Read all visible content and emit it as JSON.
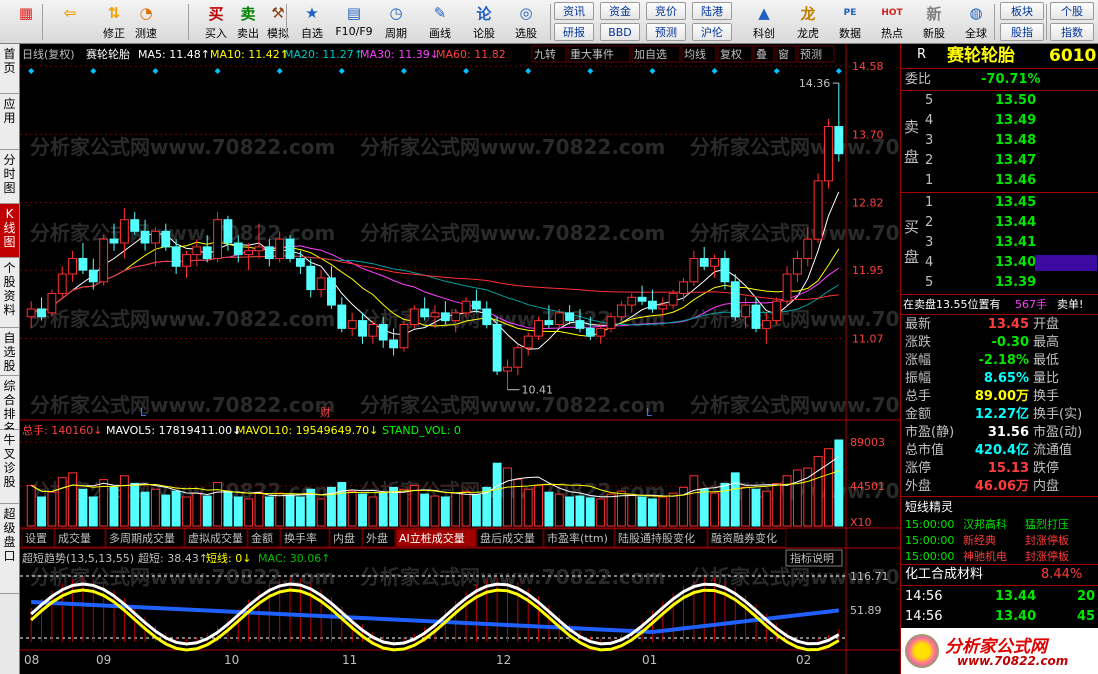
{
  "toolbar": {
    "buttons": [
      {
        "label": "",
        "icon": "windows-grid-icon"
      },
      {
        "label": "",
        "icon": "back-arrow-icon"
      },
      {
        "label": "修正",
        "icon": "up-down-arrows-icon"
      },
      {
        "label": "测速",
        "icon": "speed-icon"
      },
      {
        "label": "买入",
        "icon": "buy-icon",
        "glyph": "买"
      },
      {
        "label": "卖出",
        "icon": "sell-icon",
        "glyph": "卖"
      },
      {
        "label": "模拟",
        "icon": "hammer-icon"
      },
      {
        "label": "自选",
        "icon": "star-icon"
      },
      {
        "label": "F10/F9",
        "icon": "f10-icon"
      },
      {
        "label": "周期",
        "icon": "period-icon"
      },
      {
        "label": "画线",
        "icon": "pencil-icon"
      },
      {
        "label": "论股",
        "icon": "discuss-icon",
        "glyph": "论"
      },
      {
        "label": "选股",
        "icon": "select-stock-icon"
      }
    ],
    "mid_buttons": [
      [
        "资讯",
        "研报"
      ],
      [
        "资金",
        "BBD"
      ],
      [
        "竞价",
        "预测"
      ],
      [
        "陆港",
        "沪伦"
      ]
    ],
    "right_buttons": [
      {
        "label": "科创",
        "icon": "kechuang-icon"
      },
      {
        "label": "龙虎",
        "icon": "dragon-tiger-icon"
      },
      {
        "label": "数据",
        "icon": "pe-icon",
        "glyph": "PE"
      },
      {
        "label": "热点",
        "icon": "hot-icon",
        "glyph": "HOT"
      },
      {
        "label": "新股",
        "icon": "new-stock-icon"
      },
      {
        "label": "全球",
        "icon": "globe-icon"
      }
    ],
    "far_right": [
      [
        "板块",
        "股指"
      ],
      [
        "个股",
        "指数"
      ]
    ]
  },
  "left_tabs": [
    "首页",
    "应用",
    "分时图",
    "K线图",
    "个股资料",
    "自选股",
    "综合排名",
    "牛叉诊股",
    "超级盘口"
  ],
  "chart_header": {
    "title": "日线(复权)",
    "stock": "赛轮轮胎",
    "ma": [
      {
        "label": "MA5: 11.48↑",
        "color": "#ffffff"
      },
      {
        "label": "MA10: 11.42↑",
        "color": "#ffff00"
      },
      {
        "label": "MA20: 11.27↑",
        "color": "#00c8c8"
      },
      {
        "label": "MA30: 11.39↓",
        "color": "#ff40ff"
      },
      {
        "label": "MA60: 11.82",
        "color": "#ff4040"
      }
    ],
    "buttons": [
      "九转",
      "重大事件",
      "加自选",
      "均线",
      "复权",
      "叠",
      "窗",
      "预测"
    ]
  },
  "price_axis": [
    "14.58",
    "13.70",
    "12.82",
    "11.95",
    "11.07"
  ],
  "price_annotations": {
    "high": "14.36",
    "low": "10.41",
    "marks": [
      "L",
      "财",
      "L"
    ]
  },
  "volume_header": {
    "items": [
      {
        "label": "总手: 140160↓",
        "color": "#ff4040"
      },
      {
        "label": "MAVOL5: 17819411.00↓",
        "color": "#ffffff"
      },
      {
        "label": "MAVOL10: 19549649.70↓",
        "color": "#ffff00"
      },
      {
        "label": "STAND_VOL: 0",
        "color": "#00ff00"
      }
    ]
  },
  "volume_axis": [
    "89003",
    "44501",
    "X10"
  ],
  "indicator_tabs": [
    "设置",
    "成交量",
    "多周期成交量",
    "虚拟成交量",
    "金额",
    "换手率",
    "内盘",
    "外盘",
    "AI立桩成交量",
    "盘后成交量",
    "市盈率(ttm)",
    "陆股通持股变化",
    "融资融券变化"
  ],
  "indicator_active": "AI立桩成交量",
  "osc_header": {
    "items": [
      {
        "label": "超短趋势(13,5,13,55)",
        "color": "#c0c0c0"
      },
      {
        "label": "超短: 38.43↑",
        "color": "#c0c0c0"
      },
      {
        "label": "短线: 0↓",
        "color": "#ffff00"
      },
      {
        "label": "MAC: 30.06↑",
        "color": "#00c000"
      }
    ],
    "help": "指标说明"
  },
  "osc_axis": [
    "116.71",
    "51.89"
  ],
  "date_axis": [
    "08",
    "09",
    "10",
    "11",
    "12",
    "01",
    "02"
  ],
  "watermark": "分析家公式网www.70822.com",
  "right_panel": {
    "title_r": "R",
    "title_name": "赛轮轮胎",
    "title_code": "6010",
    "weibi_label": "委比",
    "weibi_value": "-70.71%",
    "sell_label": [
      "卖",
      "盘"
    ],
    "buy_label": [
      "买",
      "盘"
    ],
    "sell": [
      {
        "level": "5",
        "price": "13.50"
      },
      {
        "level": "4",
        "price": "13.49"
      },
      {
        "level": "3",
        "price": "13.48"
      },
      {
        "level": "2",
        "price": "13.47"
      },
      {
        "level": "1",
        "price": "13.46"
      }
    ],
    "buy": [
      {
        "level": "1",
        "price": "13.45"
      },
      {
        "level": "2",
        "price": "13.44"
      },
      {
        "level": "3",
        "price": "13.41"
      },
      {
        "level": "4",
        "price": "13.40"
      },
      {
        "level": "5",
        "price": "13.39"
      }
    ],
    "position_text": "在卖盘13.55位置有",
    "position_qty": "567手",
    "position_sell": "卖单!",
    "stats": [
      {
        "l": "最新",
        "v": "13.45",
        "vc": "red",
        "r": "开盘"
      },
      {
        "l": "涨跌",
        "v": "-0.30",
        "vc": "grn",
        "r": "最高"
      },
      {
        "l": "涨幅",
        "v": "-2.18%",
        "vc": "grn",
        "r": "最低"
      },
      {
        "l": "振幅",
        "v": "8.65%",
        "vc": "cyan",
        "r": "量比"
      },
      {
        "l": "总手",
        "v": "89.00万",
        "vc": "yel",
        "r": "换手"
      },
      {
        "l": "金额",
        "v": "12.27亿",
        "vc": "cyan",
        "r": "换手(实)"
      },
      {
        "l": "市盈(静)",
        "v": "31.56",
        "vc": "wht",
        "r": "市盈(动)"
      },
      {
        "l": "总市值",
        "v": "420.4亿",
        "vc": "cyan",
        "r": "流通值"
      },
      {
        "l": "涨停",
        "v": "15.13",
        "vc": "red",
        "r": "跌停"
      },
      {
        "l": "外盘",
        "v": "46.06万",
        "vc": "red",
        "r": "内盘"
      }
    ],
    "jingling_title": "短线精灵",
    "jingling": [
      {
        "t": "15:00:00",
        "n": "汉邦高科",
        "e": "猛烈打压"
      },
      {
        "t": "15:00:00",
        "n": "新经典",
        "e": "封涨停板"
      },
      {
        "t": "15:00:00",
        "n": "神驰机电",
        "e": "封涨停板"
      }
    ],
    "sector_name": "化工合成材料",
    "sector_pct": "8.44%",
    "ticks": [
      {
        "t": "14:56",
        "p": "13.44",
        "v": "20"
      },
      {
        "t": "14:56",
        "p": "13.40",
        "v": "45"
      }
    ],
    "logo_main": "分析家公式网",
    "logo_url": "www.70822.com"
  },
  "chart_data": {
    "type": "candlestick",
    "price_ylim": [
      10.2,
      14.58
    ],
    "candles": [
      [
        11.35,
        11.55,
        11.2,
        11.45
      ],
      [
        11.45,
        11.6,
        11.3,
        11.35
      ],
      [
        11.4,
        11.7,
        11.35,
        11.65
      ],
      [
        11.65,
        12.0,
        11.6,
        11.9
      ],
      [
        11.9,
        12.2,
        11.8,
        12.1
      ],
      [
        12.1,
        12.3,
        11.9,
        11.95
      ],
      [
        11.95,
        12.1,
        11.7,
        11.8
      ],
      [
        11.8,
        12.4,
        11.75,
        12.35
      ],
      [
        12.35,
        12.55,
        12.2,
        12.3
      ],
      [
        12.3,
        12.75,
        12.1,
        12.6
      ],
      [
        12.6,
        12.7,
        12.4,
        12.45
      ],
      [
        12.45,
        12.6,
        12.2,
        12.3
      ],
      [
        12.3,
        12.5,
        12.0,
        12.45
      ],
      [
        12.45,
        12.55,
        12.2,
        12.25
      ],
      [
        12.25,
        12.35,
        11.9,
        12.0
      ],
      [
        12.0,
        12.2,
        11.85,
        12.15
      ],
      [
        12.15,
        12.35,
        12.0,
        12.25
      ],
      [
        12.25,
        12.4,
        12.05,
        12.1
      ],
      [
        12.1,
        12.7,
        12.05,
        12.6
      ],
      [
        12.6,
        12.65,
        12.2,
        12.3
      ],
      [
        12.3,
        12.4,
        12.05,
        12.15
      ],
      [
        12.15,
        12.3,
        11.95,
        12.2
      ],
      [
        12.2,
        12.55,
        12.1,
        12.25
      ],
      [
        12.25,
        12.35,
        12.0,
        12.1
      ],
      [
        12.1,
        12.45,
        12.05,
        12.35
      ],
      [
        12.35,
        12.4,
        12.05,
        12.1
      ],
      [
        12.1,
        12.2,
        11.9,
        12.0
      ],
      [
        12.0,
        12.1,
        11.6,
        11.7
      ],
      [
        11.7,
        11.95,
        11.6,
        11.85
      ],
      [
        11.85,
        12.0,
        11.45,
        11.5
      ],
      [
        11.5,
        11.6,
        11.15,
        11.2
      ],
      [
        11.2,
        11.4,
        11.1,
        11.3
      ],
      [
        11.3,
        11.4,
        11.0,
        11.1
      ],
      [
        11.1,
        11.3,
        11.0,
        11.25
      ],
      [
        11.25,
        11.35,
        10.95,
        11.05
      ],
      [
        11.05,
        11.2,
        10.85,
        10.95
      ],
      [
        10.95,
        11.3,
        10.9,
        11.25
      ],
      [
        11.25,
        11.5,
        11.2,
        11.45
      ],
      [
        11.45,
        11.6,
        11.3,
        11.35
      ],
      [
        11.35,
        11.5,
        11.2,
        11.4
      ],
      [
        11.4,
        11.55,
        11.25,
        11.3
      ],
      [
        11.3,
        11.45,
        11.15,
        11.4
      ],
      [
        11.4,
        11.6,
        11.35,
        11.55
      ],
      [
        11.55,
        11.7,
        11.4,
        11.45
      ],
      [
        11.45,
        11.55,
        11.2,
        11.25
      ],
      [
        11.25,
        11.35,
        10.6,
        10.65
      ],
      [
        10.65,
        10.8,
        10.41,
        10.7
      ],
      [
        10.7,
        11.0,
        10.6,
        10.95
      ],
      [
        10.95,
        11.15,
        10.85,
        11.1
      ],
      [
        11.1,
        11.35,
        11.05,
        11.3
      ],
      [
        11.3,
        11.5,
        11.2,
        11.25
      ],
      [
        11.25,
        11.45,
        11.2,
        11.4
      ],
      [
        11.4,
        11.5,
        11.25,
        11.3
      ],
      [
        11.3,
        11.45,
        11.15,
        11.2
      ],
      [
        11.2,
        11.35,
        11.05,
        11.1
      ],
      [
        11.1,
        11.25,
        11.0,
        11.2
      ],
      [
        11.2,
        11.4,
        11.15,
        11.35
      ],
      [
        11.35,
        11.55,
        11.3,
        11.5
      ],
      [
        11.5,
        11.65,
        11.4,
        11.6
      ],
      [
        11.6,
        11.75,
        11.5,
        11.55
      ],
      [
        11.55,
        11.7,
        11.4,
        11.45
      ],
      [
        11.45,
        11.6,
        11.35,
        11.5
      ],
      [
        11.5,
        11.7,
        11.45,
        11.65
      ],
      [
        11.65,
        11.85,
        11.55,
        11.8
      ],
      [
        11.8,
        12.2,
        11.75,
        12.1
      ],
      [
        12.1,
        12.25,
        11.95,
        12.0
      ],
      [
        12.0,
        12.15,
        11.85,
        12.1
      ],
      [
        12.1,
        12.2,
        11.7,
        11.8
      ],
      [
        11.8,
        11.9,
        11.3,
        11.35
      ],
      [
        11.35,
        11.6,
        11.2,
        11.5
      ],
      [
        11.5,
        11.6,
        11.15,
        11.2
      ],
      [
        11.2,
        11.4,
        11.0,
        11.3
      ],
      [
        11.3,
        11.6,
        11.25,
        11.55
      ],
      [
        11.55,
        12.0,
        11.5,
        11.9
      ],
      [
        11.9,
        12.2,
        11.8,
        12.1
      ],
      [
        12.1,
        12.5,
        12.0,
        12.35
      ],
      [
        12.35,
        13.2,
        12.3,
        13.1
      ],
      [
        13.1,
        13.9,
        13.0,
        13.8
      ],
      [
        13.8,
        14.36,
        13.35,
        13.45
      ]
    ],
    "volume_ylim": [
      0,
      89003
    ],
    "volume": [
      42,
      30,
      35,
      50,
      55,
      38,
      30,
      48,
      40,
      52,
      44,
      35,
      38,
      32,
      36,
      30,
      34,
      31,
      45,
      36,
      30,
      28,
      35,
      30,
      34,
      32,
      30,
      38,
      28,
      40,
      45,
      36,
      33,
      30,
      34,
      40,
      38,
      42,
      33,
      31,
      30,
      34,
      36,
      32,
      40,
      65,
      60,
      48,
      38,
      42,
      35,
      33,
      30,
      31,
      29,
      28,
      33,
      36,
      32,
      30,
      28,
      30,
      34,
      40,
      52,
      38,
      34,
      44,
      55,
      40,
      38,
      36,
      44,
      52,
      58,
      60,
      72,
      80,
      89
    ],
    "osc_ylim": [
      0,
      116.71
    ]
  }
}
